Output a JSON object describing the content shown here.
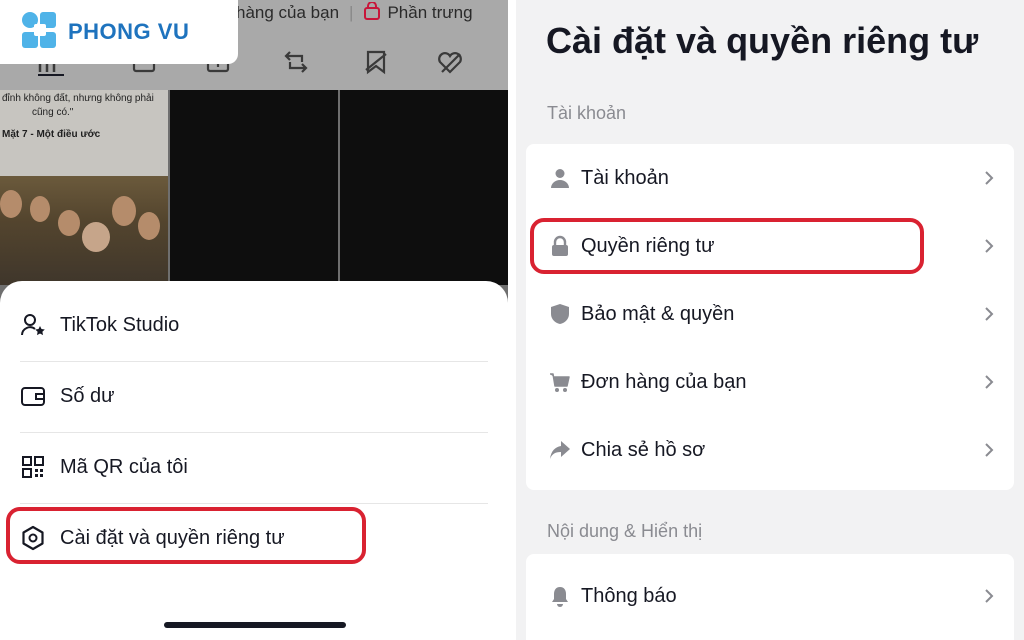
{
  "logo": {
    "text": "PHONG VU"
  },
  "top_bar": {
    "orders_link": "hàng của bạn",
    "showcase_link": "Phần trưng"
  },
  "video_caption": {
    "line1": "đỉnh không đất, nhưng không phải",
    "line2": "cũng có.\"",
    "line3": "Mặt 7 - Một điều ước"
  },
  "bottom_sheet": {
    "items": [
      {
        "label": "TikTok Studio",
        "icon": "person-star-icon"
      },
      {
        "label": "Số dư",
        "icon": "wallet-icon"
      },
      {
        "label": "Mã QR của tôi",
        "icon": "qr-code-icon"
      },
      {
        "label": "Cài đặt và quyền riêng tư",
        "icon": "gear-icon"
      }
    ]
  },
  "settings": {
    "title": "Cài đặt và quyền riêng tư",
    "sections": [
      {
        "label": "Tài khoản",
        "rows": [
          {
            "label": "Tài khoản",
            "icon": "person-icon"
          },
          {
            "label": "Quyền riêng tư",
            "icon": "lock-icon"
          },
          {
            "label": "Bảo mật & quyền",
            "icon": "shield-icon"
          },
          {
            "label": "Đơn hàng của bạn",
            "icon": "cart-icon"
          },
          {
            "label": "Chia sẻ hồ sơ",
            "icon": "share-icon"
          }
        ]
      },
      {
        "label": "Nội dung & Hiển thị",
        "rows": [
          {
            "label": "Thông báo",
            "icon": "bell-icon"
          }
        ]
      }
    ]
  },
  "colors": {
    "highlight": "#d92231",
    "logo_blue": "#1e73be",
    "logo_cyan": "#4fb3e8",
    "text_primary": "#161823",
    "text_secondary": "#8a8b91"
  }
}
